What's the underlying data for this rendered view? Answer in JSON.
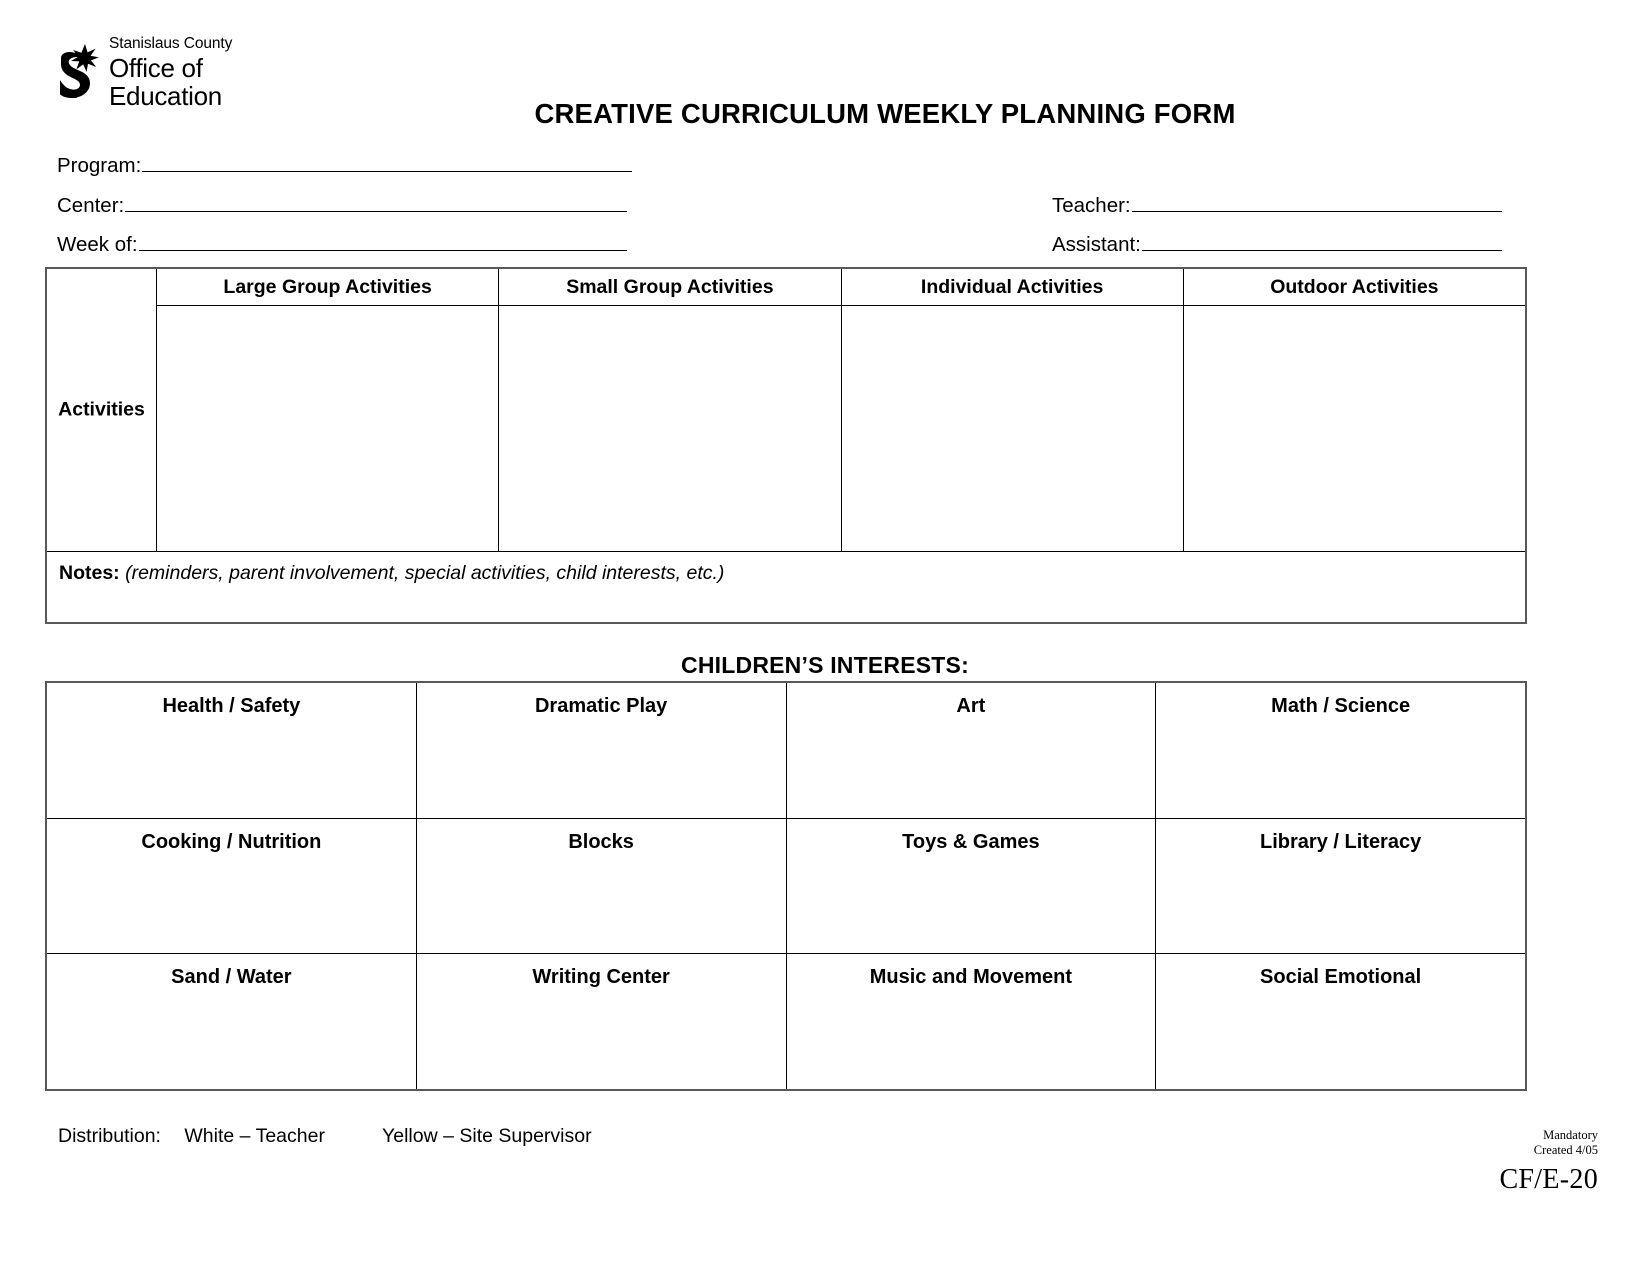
{
  "logo": {
    "line1": "Stanislaus County",
    "line2": "Office of",
    "line3": "Education",
    "mark": "soe-star-s-mark"
  },
  "title": "CREATIVE CURRICULUM WEEKLY PLANNING FORM",
  "header_fields": {
    "program": "Program:",
    "center": "Center:",
    "week_of": "Week of:",
    "teacher": "Teacher:",
    "assistant": "Assistant:",
    "values": {
      "program": "",
      "center": "",
      "week_of": "",
      "teacher": "",
      "assistant": ""
    }
  },
  "activities": {
    "row_label": "Activities",
    "columns": [
      "Large Group Activities",
      "Small Group Activities",
      "Individual Activities",
      "Outdoor Activities"
    ],
    "cells": [
      "",
      "",
      "",
      ""
    ],
    "notes_label": "Notes:",
    "notes_hint": "(reminders, parent involvement, special activities, child interests, etc.)",
    "notes_value": ""
  },
  "interests": {
    "title": "CHILDREN’S INTERESTS:",
    "rows": [
      [
        "Health / Safety",
        "Dramatic Play",
        "Art",
        "Math / Science"
      ],
      [
        "Cooking / Nutrition",
        "Blocks",
        "Toys & Games",
        "Library / Literacy"
      ],
      [
        "Sand / Water",
        "Writing Center",
        "Music and Movement",
        "Social Emotional"
      ]
    ]
  },
  "footer": {
    "distribution_label": "Distribution:",
    "distribution_white": "White – Teacher",
    "distribution_yellow": "Yellow – Site Supervisor",
    "mandatory": "Mandatory",
    "created": "Created 4/05",
    "form_code": "CF/E-20"
  },
  "colors": {
    "ink": "#000000",
    "table_border": "#595959",
    "paper": "#ffffff"
  }
}
